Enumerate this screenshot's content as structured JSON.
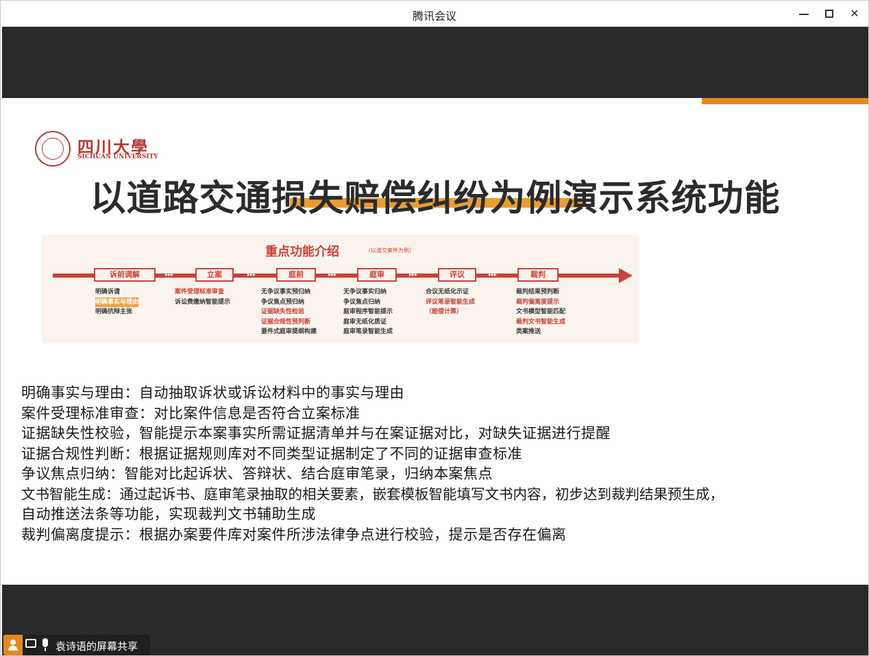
{
  "window": {
    "title": "腾讯会议",
    "controls": {
      "minimize": "—",
      "maximize": "□",
      "close": "✕"
    }
  },
  "slide": {
    "logo": {
      "cn": "四川大學",
      "en": "SICHUAN UNIVERSITY"
    },
    "title": "以道路交通损失赔偿纠纷为例演示系统功能",
    "diagram": {
      "title": "重点功能介绍",
      "subtitle": "（以道交案件为例）",
      "stages": [
        "诉前调解",
        "立案",
        "庭前",
        "庭审",
        "评议",
        "裁判"
      ],
      "dots": "▸▸▸",
      "columns": [
        {
          "items": [
            "明确诉请",
            "明确事实与理由",
            "明确抗辩主张"
          ]
        },
        {
          "items": [
            "案件受理标准审查",
            "诉讼费缴纳智能提示"
          ]
        },
        {
          "items": [
            "无争议事实预归纳",
            "争议焦点预归纳",
            "证据缺失性检验",
            "证据合规性预判断",
            "要件式庭审提纲构建"
          ]
        },
        {
          "items": [
            "无争议事实归纳",
            "争议焦点归纳",
            "庭审程序智能提示",
            "庭审无纸化质证",
            "庭审笔录智能生成"
          ]
        },
        {
          "items": [
            "合议无纸化示证",
            "评议笔录智能生成",
            "（赔偿计算）"
          ]
        },
        {
          "items": [
            "裁判结果预判断",
            "裁判偏离度提示",
            "文书模型智能匹配",
            "裁判文书智能生成",
            "类案推送"
          ]
        }
      ]
    },
    "lines": [
      "明确事实与理由：自动抽取诉状或诉讼材料中的事实与理由",
      "案件受理标准审查：对比案件信息是否符合立案标准",
      "证据缺失性校验，智能提示本案事实所需证据清单并与在案证据对比，对缺失证据进行提醒",
      "证据合规性判断：根据证据规则库对不同类型证据制定了不同的证据审查标准",
      "争议焦点归纳：智能对比起诉状、答辩状、结合庭审笔录，归纳本案焦点",
      "文书智能生成：通过起诉书、庭审笔录抽取的相关要素，嵌套模板智能填写文书内容，初步达到裁判结果预生成，",
      "自动推送法条等功能，实现裁判文书辅助生成",
      "裁判偏离度提示：根据办案要件库对案件所涉法律争点进行校验，提示是否存在偏离"
    ]
  },
  "share_bar": {
    "text": "袁诗语的屏幕共享"
  },
  "colors": {
    "accent_orange": "#e48a1c",
    "brand_red": "#c8423a",
    "dark_bar": "#2a2a2c"
  }
}
